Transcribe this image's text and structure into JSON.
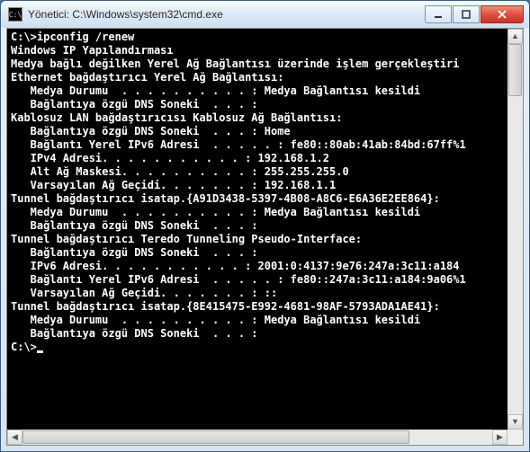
{
  "window": {
    "title": "Yönetici: C:\\Windows\\system32\\cmd.exe",
    "icon_label": "cmd-icon"
  },
  "console": {
    "lines": [
      "C:\\>ipconfig /renew",
      "",
      "Windows IP Yapılandırması",
      "",
      "Medya bağlı değilken Yerel Ağ Bağlantısı üzerinde işlem gerçekleştiri",
      "",
      "Ethernet bağdaştırıcı Yerel Ağ Bağlantısı:",
      "",
      "   Medya Durumu  . . . . . . . . . . : Medya Bağlantısı kesildi",
      "   Bağlantıya özgü DNS Soneki  . . . :",
      "",
      "Kablosuz LAN bağdaştırıcısı Kablosuz Ağ Bağlantısı:",
      "",
      "   Bağlantıya özgü DNS Soneki  . . . : Home",
      "   Bağlantı Yerel IPv6 Adresi  . . . . . : fe80::80ab:41ab:84bd:67ff%1",
      "   IPv4 Adresi. . . . . . . . . . . : 192.168.1.2",
      "   Alt Ağ Maskesi. . . . . . . . . . : 255.255.255.0",
      "   Varsayılan Ağ Geçidi. . . . . . . : 192.168.1.1",
      "",
      "Tunnel bağdaştırıcı isatap.{A91D3438-5397-4B08-A8C6-E6A36E2EE864}:",
      "",
      "   Medya Durumu  . . . . . . . . . . : Medya Bağlantısı kesildi",
      "   Bağlantıya özgü DNS Soneki  . . . :",
      "",
      "Tunnel bağdaştırıcı Teredo Tunneling Pseudo-Interface:",
      "",
      "   Bağlantıya özgü DNS Soneki  . . . :",
      "   IPv6 Adresi. . . . . . . . . . . : 2001:0:4137:9e76:247a:3c11:a184",
      "   Bağlantı Yerel IPv6 Adresi  . . . . . : fe80::247a:3c11:a184:9a06%1",
      "   Varsayılan Ağ Geçidi. . . . . . . : ::",
      "",
      "Tunnel bağdaştırıcı isatap.{8E415475-E992-4681-98AF-5793ADA1AE41}:",
      "",
      "   Medya Durumu  . . . . . . . . . . : Medya Bağlantısı kesildi",
      "   Bağlantıya özgü DNS Soneki  . . . :",
      "",
      "C:\\>"
    ]
  },
  "scroll": {
    "arrows": {
      "up": "▲",
      "down": "▼",
      "left": "◀",
      "right": "▶"
    }
  }
}
